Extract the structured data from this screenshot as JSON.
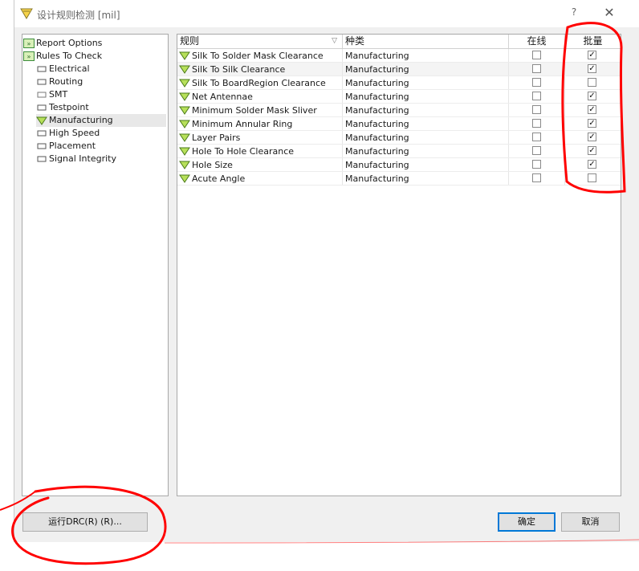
{
  "window": {
    "title": "设计规则检测 [mil]",
    "help_label": "?",
    "close_label": "✕"
  },
  "tree": {
    "items": [
      {
        "label": "Report Options",
        "icon": "report-options-icon",
        "level": 0
      },
      {
        "label": "Rules To Check",
        "icon": "rules-to-check-icon",
        "level": 0
      },
      {
        "label": "Electrical",
        "icon": "electrical-icon",
        "level": 1
      },
      {
        "label": "Routing",
        "icon": "routing-icon",
        "level": 1
      },
      {
        "label": "SMT",
        "icon": "smt-icon",
        "level": 1
      },
      {
        "label": "Testpoint",
        "icon": "testpoint-icon",
        "level": 1
      },
      {
        "label": "Manufacturing",
        "icon": "manufacturing-icon",
        "level": 1,
        "selected": true
      },
      {
        "label": "High Speed",
        "icon": "high-speed-icon",
        "level": 1
      },
      {
        "label": "Placement",
        "icon": "placement-icon",
        "level": 1
      },
      {
        "label": "Signal Integrity",
        "icon": "signal-integrity-icon",
        "level": 1
      }
    ]
  },
  "grid": {
    "headers": {
      "rule": "规则",
      "kind": "种类",
      "online": "在线",
      "batch": "批量"
    },
    "sort_indicator": "▽",
    "rows": [
      {
        "rule": "Silk To Solder Mask Clearance",
        "kind": "Manufacturing",
        "online": false,
        "batch": true
      },
      {
        "rule": "Silk To Silk Clearance",
        "kind": "Manufacturing",
        "online": false,
        "batch": true
      },
      {
        "rule": "Silk To BoardRegion Clearance",
        "kind": "Manufacturing",
        "online": false,
        "batch": false
      },
      {
        "rule": "Net Antennae",
        "kind": "Manufacturing",
        "online": false,
        "batch": true
      },
      {
        "rule": "Minimum Solder Mask Sliver",
        "kind": "Manufacturing",
        "online": false,
        "batch": true
      },
      {
        "rule": "Minimum Annular Ring",
        "kind": "Manufacturing",
        "online": false,
        "batch": true
      },
      {
        "rule": "Layer Pairs",
        "kind": "Manufacturing",
        "online": false,
        "batch": true
      },
      {
        "rule": "Hole To Hole Clearance",
        "kind": "Manufacturing",
        "online": false,
        "batch": true
      },
      {
        "rule": "Hole Size",
        "kind": "Manufacturing",
        "online": false,
        "batch": true
      },
      {
        "rule": "Acute Angle",
        "kind": "Manufacturing",
        "online": false,
        "batch": false
      }
    ]
  },
  "buttons": {
    "run_drc": "运行DRC(R) (R)...",
    "ok": "确定",
    "cancel": "取消"
  },
  "check_mark": "✓",
  "colors": {
    "annotation": "#ff0000",
    "accent": "#0078d7",
    "rule_icon": "#7fb832"
  }
}
